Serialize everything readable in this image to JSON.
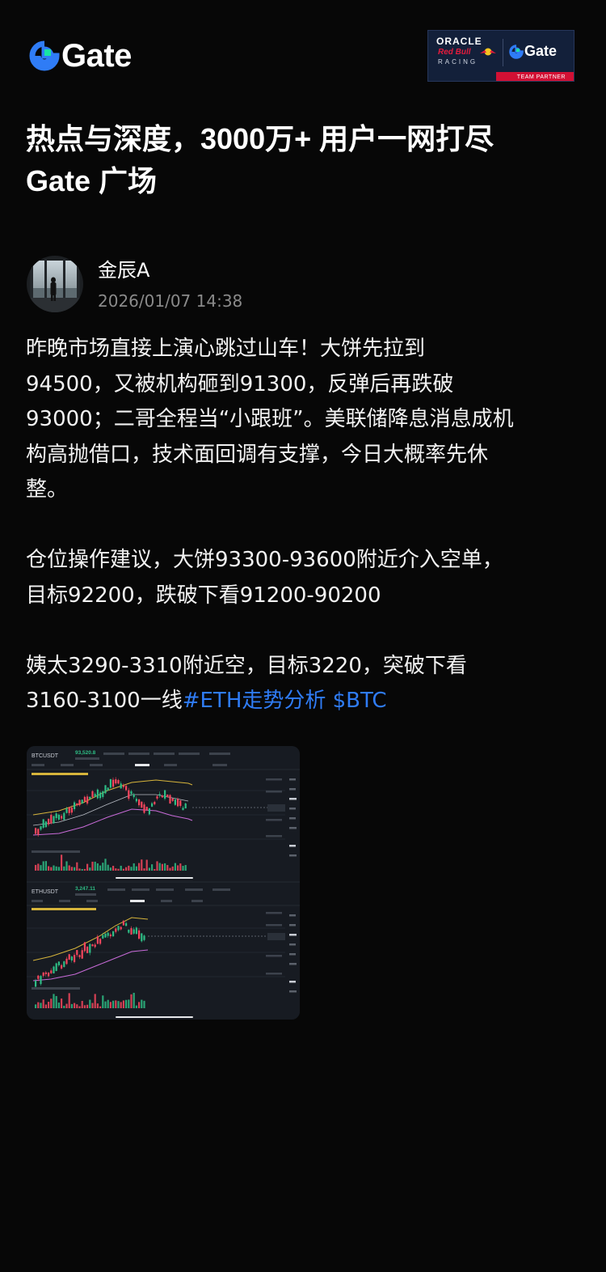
{
  "brand": {
    "name": "Gate",
    "accent": "#2f7cf6",
    "mark_color": "#17e5a4"
  },
  "partner_badge": {
    "oracle": "ORACLE",
    "red_bull": "Red Bull",
    "racing": "RACING",
    "gate": "Gate",
    "team_partner": "TEAM PARTNER"
  },
  "headline": {
    "line1": "热点与深度，3000万+ 用户一网打尽",
    "line2": "Gate 广场"
  },
  "author": {
    "name": "金辰A",
    "timestamp": "2026/01/07 14:38"
  },
  "post": {
    "paragraph1": "昨晚市场直接上演心跳过山车！大饼先拉到\n94500，又被机构砸到91300，反弹后再跌破\n93000；二哥全程当“小跟班”。美联储降息消息成机\n构高抛借口，技术面回调有支撑，今日大概率先休\n整。",
    "paragraph2": "仓位操作建议，大饼93300-93600附近介入空单，\n目标92200，跌破下看91200-90200",
    "paragraph3_prefix": "姨太3290-3310附近空，目标3220，突破下看\n3160-3100一线",
    "tags": [
      "#ETH走势分析",
      "$BTC"
    ]
  },
  "chart_image": {
    "btc": {
      "symbol": "BTCUSDT",
      "price": "93,520.8"
    },
    "eth": {
      "symbol": "ETHUSDT",
      "price": "3,247.11"
    }
  }
}
